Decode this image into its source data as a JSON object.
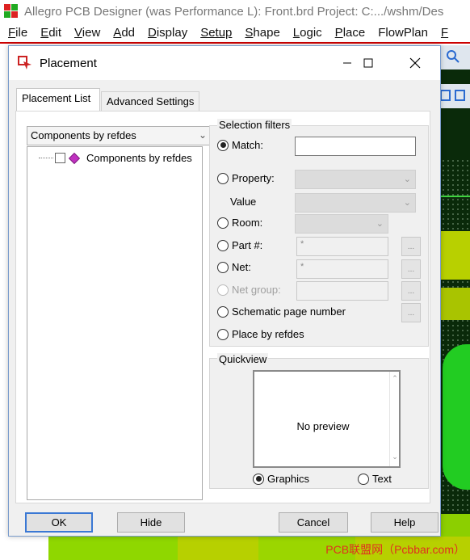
{
  "app": {
    "title": "Allegro PCB Designer (was Performance L): Front.brd  Project: C:.../wshm/Des",
    "menu": [
      {
        "label": "File",
        "u": "F",
        "rest": "ile"
      },
      {
        "label": "Edit",
        "u": "E",
        "rest": "dit"
      },
      {
        "label": "View",
        "u": "V",
        "rest": "iew"
      },
      {
        "label": "Add",
        "u": "A",
        "rest": "dd"
      },
      {
        "label": "Display",
        "u": "D",
        "rest": "isplay"
      },
      {
        "label": "Setup",
        "u": "",
        "rest": "Setup"
      },
      {
        "label": "Shape",
        "u": "S",
        "rest": "hape"
      },
      {
        "label": "Logic",
        "u": "L",
        "rest": "ogic"
      },
      {
        "label": "Place",
        "u": "P",
        "rest": "lace"
      },
      {
        "label": "FlowPlan",
        "u": "",
        "rest": "FlowPlan"
      },
      {
        "label": "F",
        "u": "F",
        "rest": ""
      }
    ]
  },
  "dialog": {
    "title": "Placement",
    "tabs": {
      "list": "Placement List",
      "advanced": "Advanced Settings"
    },
    "list": {
      "combo_value": "Components by refdes",
      "tree_item": "Components by refdes"
    },
    "filters": {
      "group_label": "Selection filters",
      "match": "Match:",
      "match_value": "",
      "property": "Property:",
      "value": "Value",
      "room": "Room:",
      "part": "Part #:",
      "part_value": "*",
      "net": "Net:",
      "net_value": "*",
      "net_group": "Net group:",
      "schematic": "Schematic page number",
      "place_by_refdes": "Place by refdes",
      "dots": "..."
    },
    "quickview": {
      "group_label": "Quickview",
      "preview_text": "No preview",
      "graphics": "Graphics",
      "text": "Text"
    },
    "buttons": {
      "ok": "OK",
      "hide": "Hide",
      "cancel": "Cancel",
      "help": "Help"
    }
  },
  "watermark": "PCB联盟网（Pcbbar.com）"
}
